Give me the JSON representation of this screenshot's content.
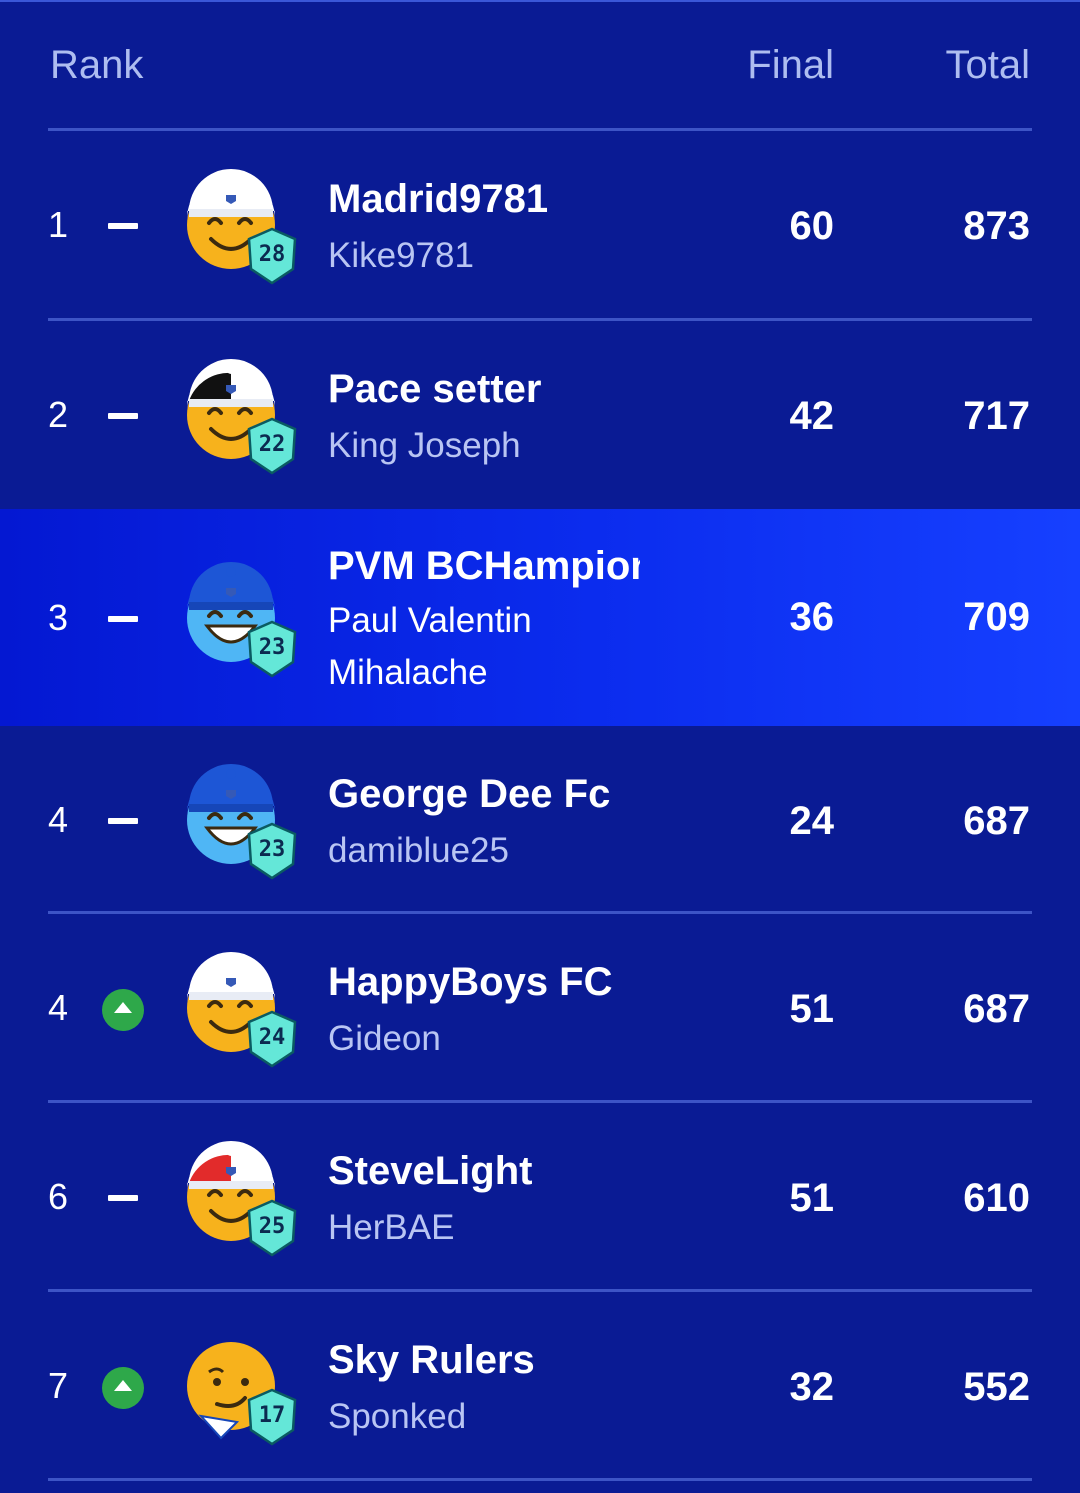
{
  "header": {
    "rank": "Rank",
    "final": "Final",
    "total": "Total"
  },
  "rows": [
    {
      "rank": "1",
      "movement": "same",
      "team": "Madrid9781",
      "manager": "Kike9781",
      "final": "60",
      "total": "873",
      "level": "28",
      "avatar_face": "smile",
      "avatar_skin": "#f7b21c",
      "avatar_hat": "#ffffff",
      "avatar_hat_stripe": "#ffffff"
    },
    {
      "rank": "2",
      "movement": "same",
      "team": "Pace setter",
      "manager": "King Joseph",
      "final": "42",
      "total": "717",
      "level": "22",
      "avatar_face": "smile",
      "avatar_skin": "#f7b21c",
      "avatar_hat": "#ffffff",
      "avatar_hat_stripe": "#111111"
    },
    {
      "rank": "3",
      "movement": "same",
      "team": "PVM BCHampion",
      "manager": "Paul Valentin Mihalache",
      "final": "36",
      "total": "709",
      "level": "23",
      "avatar_face": "grin",
      "avatar_skin": "#4fb6f5",
      "avatar_hat": "#1d56d6",
      "avatar_hat_stripe": "#1d56d6",
      "highlighted": true
    },
    {
      "rank": "4",
      "movement": "same",
      "team": "George Dee Fc",
      "manager": "damiblue25",
      "final": "24",
      "total": "687",
      "level": "23",
      "avatar_face": "grin",
      "avatar_skin": "#4fb6f5",
      "avatar_hat": "#1d56d6",
      "avatar_hat_stripe": "#1d56d6"
    },
    {
      "rank": "4",
      "movement": "up",
      "team": "HappyBoys FC",
      "manager": "Gideon",
      "final": "51",
      "total": "687",
      "level": "24",
      "avatar_face": "smile",
      "avatar_skin": "#f7b21c",
      "avatar_hat": "#ffffff",
      "avatar_hat_stripe": "#ffffff"
    },
    {
      "rank": "6",
      "movement": "same",
      "team": "SteveLight",
      "manager": "HerBAE",
      "final": "51",
      "total": "610",
      "level": "25",
      "avatar_face": "smile",
      "avatar_skin": "#f7b21c",
      "avatar_hat": "#ffffff",
      "avatar_hat_stripe": "#e22b2b"
    },
    {
      "rank": "7",
      "movement": "up",
      "team": "Sky Rulers",
      "manager": "Sponked",
      "final": "32",
      "total": "552",
      "level": "17",
      "avatar_face": "smirk",
      "avatar_skin": "#f7b21c",
      "avatar_hat": "",
      "avatar_hat_stripe": ""
    }
  ]
}
